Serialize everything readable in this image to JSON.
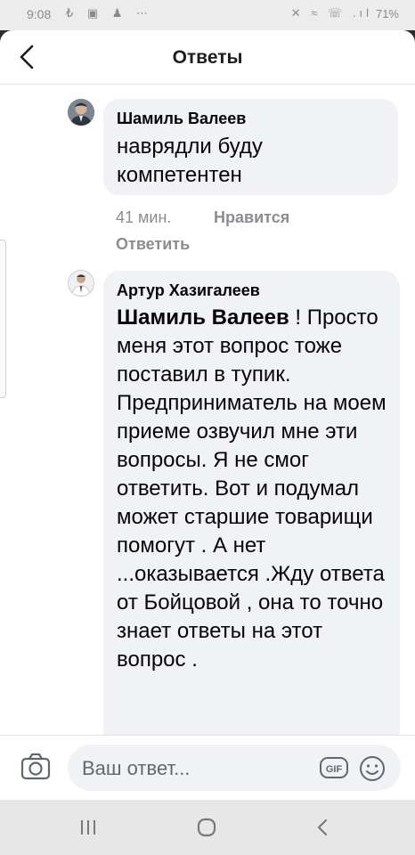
{
  "status_bar": {
    "time": "9:08",
    "left_icons": "₺ ▣ ♟ ⋯",
    "right_icons": "✕ ≈ ☏ .ıl",
    "battery": "71%"
  },
  "header": {
    "title": "Ответы",
    "back_icon": "chevron-left-icon"
  },
  "comments": [
    {
      "author": "Шамиль Валеев",
      "text": "наврядли буду компетентен",
      "time": "41 мин.",
      "like_label": "Нравится",
      "reply_label": "Ответить"
    },
    {
      "author": "Артур Хазигалеев",
      "mention": "Шамиль Валеев",
      "text_after_mention": " ! Просто меня этот вопрос тоже поставил в тупик. Предприниматель на моем приеме озвучил мне эти вопросы. Я не смог ответить. Вот и подумал может старшие товарищи помогут . А нет ...оказывается .Жду ответа от Бойцовой , она то точно знает ответы на этот вопрос ."
    }
  ],
  "composer": {
    "placeholder": "Ваш ответ...",
    "gif_label": "GIF",
    "camera_icon": "camera-icon",
    "emoji_icon": "emoji-icon"
  },
  "colors": {
    "bubble": "#f0f2f5",
    "meta": "#8a8d91",
    "text": "#050505"
  }
}
